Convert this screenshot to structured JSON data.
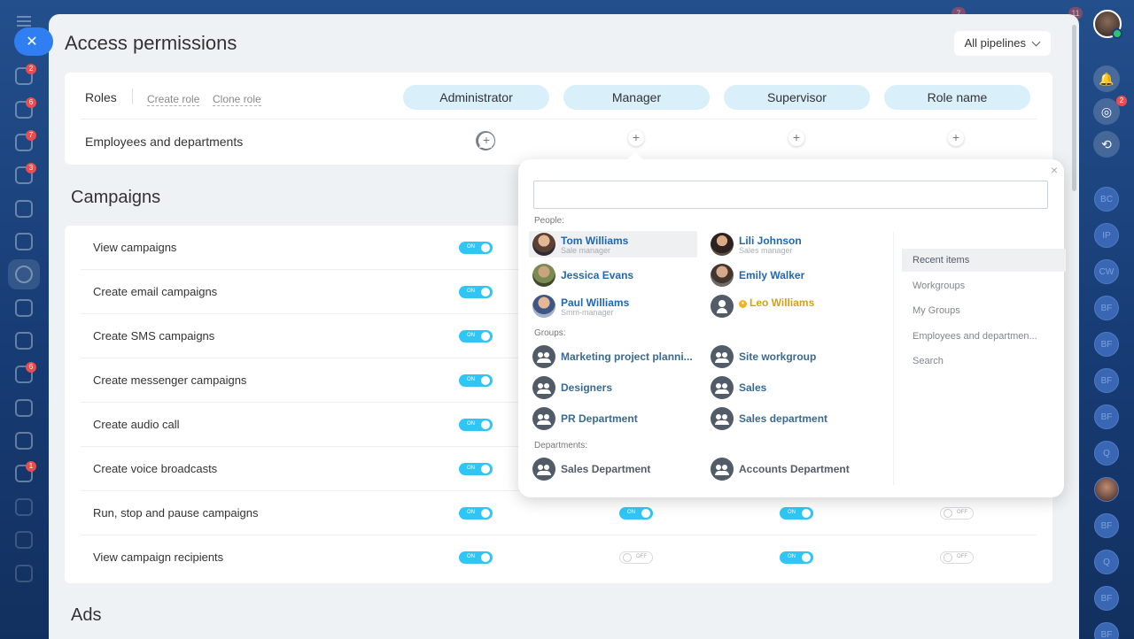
{
  "window": {
    "title": "Access permissions",
    "pipelines_label": "All pipelines"
  },
  "left_badges": [
    "2",
    "6",
    "7",
    "3",
    "6",
    "1"
  ],
  "top_badges": [
    "7",
    "11"
  ],
  "right_bar": {
    "notif_badge": "2",
    "avatars": [
      "BC",
      "IP",
      "CW",
      "BF",
      "BF",
      "BF",
      "BF",
      "Q",
      "BF",
      "Q",
      "BF",
      "BF"
    ]
  },
  "roles": {
    "label": "Roles",
    "create_role": "Create role",
    "clone_role": "Clone role",
    "columns": [
      "Administrator",
      "Manager",
      "Supervisor",
      "Role name"
    ],
    "employees_label": "Employees and departments"
  },
  "campaigns": {
    "title": "Campaigns",
    "rows": [
      {
        "label": "View campaigns",
        "states": [
          "on",
          "",
          "",
          ""
        ]
      },
      {
        "label": "Create email campaigns",
        "states": [
          "on",
          "",
          "",
          ""
        ]
      },
      {
        "label": "Create SMS campaigns",
        "states": [
          "on",
          "",
          "",
          ""
        ]
      },
      {
        "label": "Create messenger campaigns",
        "states": [
          "on",
          "",
          "",
          ""
        ]
      },
      {
        "label": "Create audio call",
        "states": [
          "on",
          "",
          "",
          ""
        ]
      },
      {
        "label": "Create voice broadcasts",
        "states": [
          "on",
          "",
          "",
          ""
        ]
      },
      {
        "label": "Run, stop and pause campaigns",
        "states": [
          "on",
          "on",
          "on",
          "off"
        ]
      },
      {
        "label": "View campaign recipients",
        "states": [
          "on",
          "off",
          "on",
          "off"
        ]
      }
    ],
    "on_text": "ON",
    "off_text": "OFF"
  },
  "ads": {
    "title": "Ads"
  },
  "popup": {
    "close": "×",
    "search_placeholder": "",
    "people_label": "People:",
    "groups_label": "Groups:",
    "departments_label": "Departments:",
    "people": [
      {
        "name": "Tom Williams",
        "role": "Sale manager"
      },
      {
        "name": "Lili Johnson",
        "role": "Sales manager"
      },
      {
        "name": "Jessica Evans",
        "role": ""
      },
      {
        "name": "Emily Walker",
        "role": ""
      },
      {
        "name": "Paul Williams",
        "role": "Smm-manager"
      },
      {
        "name": "Leo Williams",
        "role": ""
      }
    ],
    "groups": [
      "Marketing project planni...",
      "Site workgroup",
      "Designers",
      "Sales",
      "PR Department",
      "Sales department"
    ],
    "departments": [
      "Sales Department",
      "Accounts Department"
    ],
    "tabs": [
      "Recent items",
      "Workgroups",
      "My Groups",
      "Employees and departmen...",
      "Search"
    ]
  }
}
